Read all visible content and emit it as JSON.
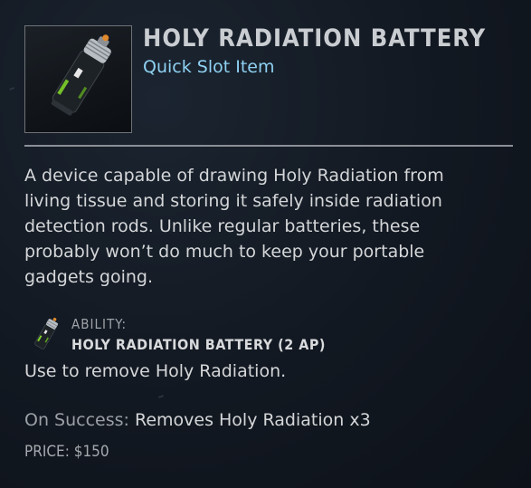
{
  "item": {
    "title": "HOLY RADIATION BATTERY",
    "subtitle": "Quick Slot Item",
    "icon": "battery-canister-icon",
    "description": "A device capable of drawing Holy Radiation from living tissue and storing it safely inside radiation detection rods. Unlike regular batteries, these probably won’t do much to keep your portable gadgets going."
  },
  "ability": {
    "label": "ABILITY:",
    "name": "HOLY RADIATION BATTERY (2 AP)",
    "description": "Use to remove Holy Radiation.",
    "icon": "battery-canister-icon"
  },
  "on_success": {
    "label": "On Success:",
    "value": "Removes Holy Radiation x3"
  },
  "price": "PRICE: $150",
  "colors": {
    "subtitle": "#8fd1f2",
    "accent_green": "#7fd12a",
    "background": "#121821"
  }
}
